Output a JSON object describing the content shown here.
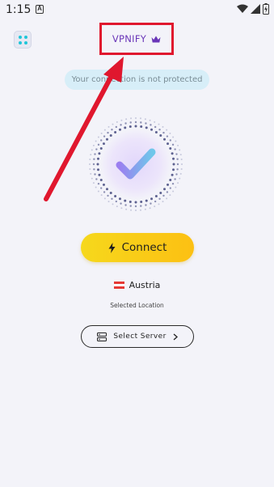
{
  "status_bar": {
    "time": "1:15",
    "notification_letter": "A"
  },
  "header": {
    "brand": "VPNIFY",
    "menu_icon": "grid-dots-icon",
    "premium_icon": "crown-icon"
  },
  "connection": {
    "status_text": "Your connection is not protected"
  },
  "connect_button": {
    "label": "Connect",
    "icon": "bolt-icon"
  },
  "location": {
    "country": "Austria",
    "caption": "Selected Location"
  },
  "server_button": {
    "label": "Select Server",
    "icon": "server-icon",
    "chevron": "chevron-right-icon"
  },
  "colors": {
    "brand": "#6a36b8",
    "accent_yellow": "#f6d81c",
    "highlight_red": "#e0172e",
    "pill_bg": "#d7eef8"
  }
}
